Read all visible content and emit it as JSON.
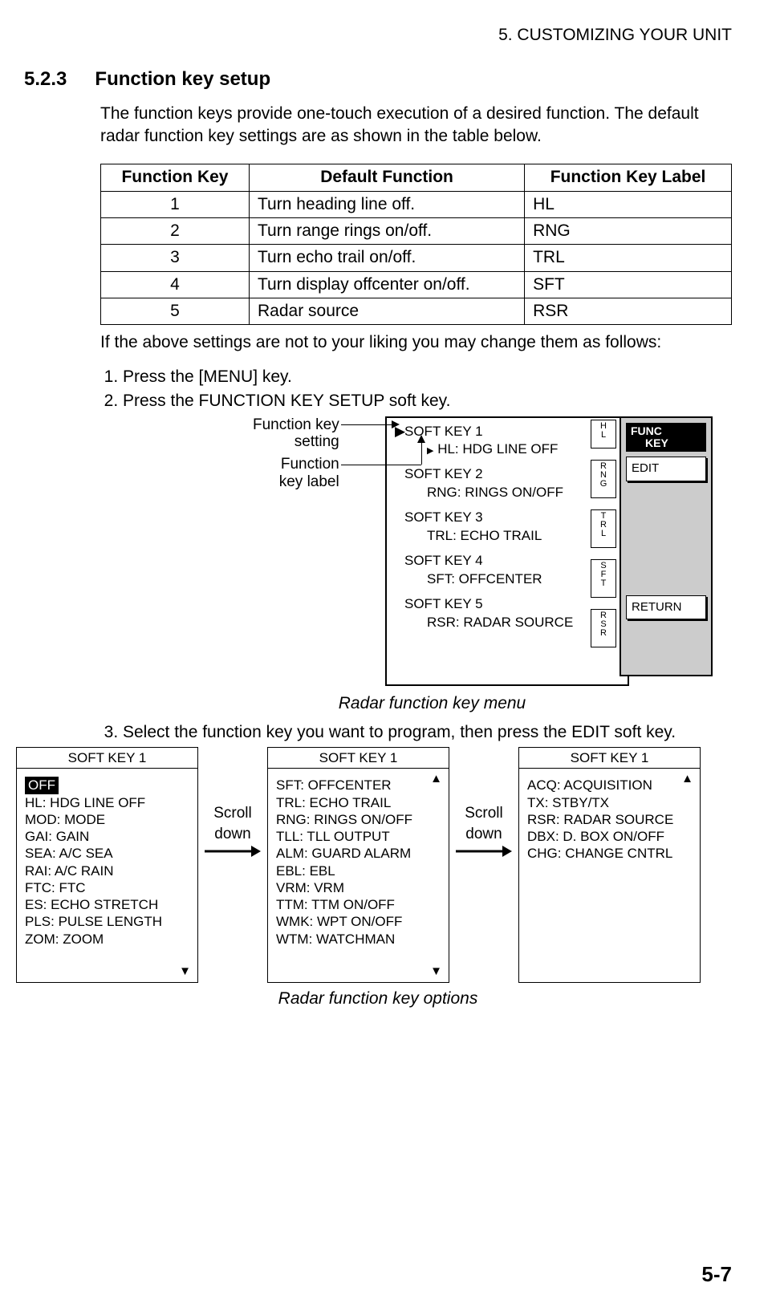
{
  "chapter_header": "5. CUSTOMIZING YOUR UNIT",
  "section_number": "5.2.3",
  "section_title": "Function key setup",
  "intro": "The function keys provide one-touch execution of a desired function. The default radar function key settings are as shown in the table below.",
  "table": {
    "headers": [
      "Function Key",
      "Default Function",
      "Function Key Label"
    ],
    "rows": [
      [
        "1",
        "Turn heading line off.",
        "HL"
      ],
      [
        "2",
        "Turn range rings on/off.",
        "RNG"
      ],
      [
        "3",
        "Turn echo trail on/off.",
        "TRL"
      ],
      [
        "4",
        "Turn display offcenter on/off.",
        "SFT"
      ],
      [
        "5",
        "Radar source",
        "RSR"
      ]
    ]
  },
  "after_table": "If the above settings are not to your liking you may change them as follows:",
  "steps": {
    "s1": "Press the [MENU] key.",
    "s2": "Press the FUNCTION KEY SETUP soft key.",
    "s3": "Select the function key you want to program, then press the EDIT soft key."
  },
  "callout": {
    "fk_setting_a": "Function key",
    "fk_setting_b": "setting",
    "fk_label_a": "Function",
    "fk_label_b": "key label"
  },
  "menu": {
    "items": [
      {
        "key": "SOFT KEY 1",
        "sub": "HL: HDG LINE OFF",
        "hw": "HL"
      },
      {
        "key": "SOFT KEY 2",
        "sub": "RNG: RINGS ON/OFF",
        "hw": "RNG"
      },
      {
        "key": "SOFT KEY 3",
        "sub": "TRL: ECHO TRAIL",
        "hw": "TRL"
      },
      {
        "key": "SOFT KEY 4",
        "sub": "SFT: OFFCENTER",
        "hw": "SFT"
      },
      {
        "key": "SOFT KEY 5",
        "sub": "RSR: RADAR SOURCE",
        "hw": "RSR"
      }
    ],
    "func_a": "FUNC",
    "func_b": "KEY",
    "edit": "EDIT",
    "return": "RETURN"
  },
  "caption1": "Radar function key menu",
  "scroll_label": "Scroll\ndown",
  "options": {
    "title": "SOFT KEY 1",
    "page1": [
      "OFF",
      "HL: HDG LINE OFF",
      "MOD: MODE",
      "GAI: GAIN",
      "SEA: A/C SEA",
      "RAI: A/C RAIN",
      "FTC: FTC",
      "ES: ECHO STRETCH",
      "PLS: PULSE LENGTH",
      "ZOM: ZOOM"
    ],
    "page2": [
      "SFT: OFFCENTER",
      "TRL: ECHO TRAIL",
      "RNG: RINGS ON/OFF",
      "TLL: TLL OUTPUT",
      "ALM: GUARD ALARM",
      "EBL: EBL",
      "VRM: VRM",
      "TTM: TTM ON/OFF",
      "WMK: WPT ON/OFF",
      "WTM: WATCHMAN"
    ],
    "page3": [
      "ACQ: ACQUISITION",
      "TX: STBY/TX",
      "RSR: RADAR SOURCE",
      "DBX: D. BOX ON/OFF",
      "CHG: CHANGE CNTRL"
    ]
  },
  "caption2": "Radar function key options",
  "page_number": "5-7"
}
